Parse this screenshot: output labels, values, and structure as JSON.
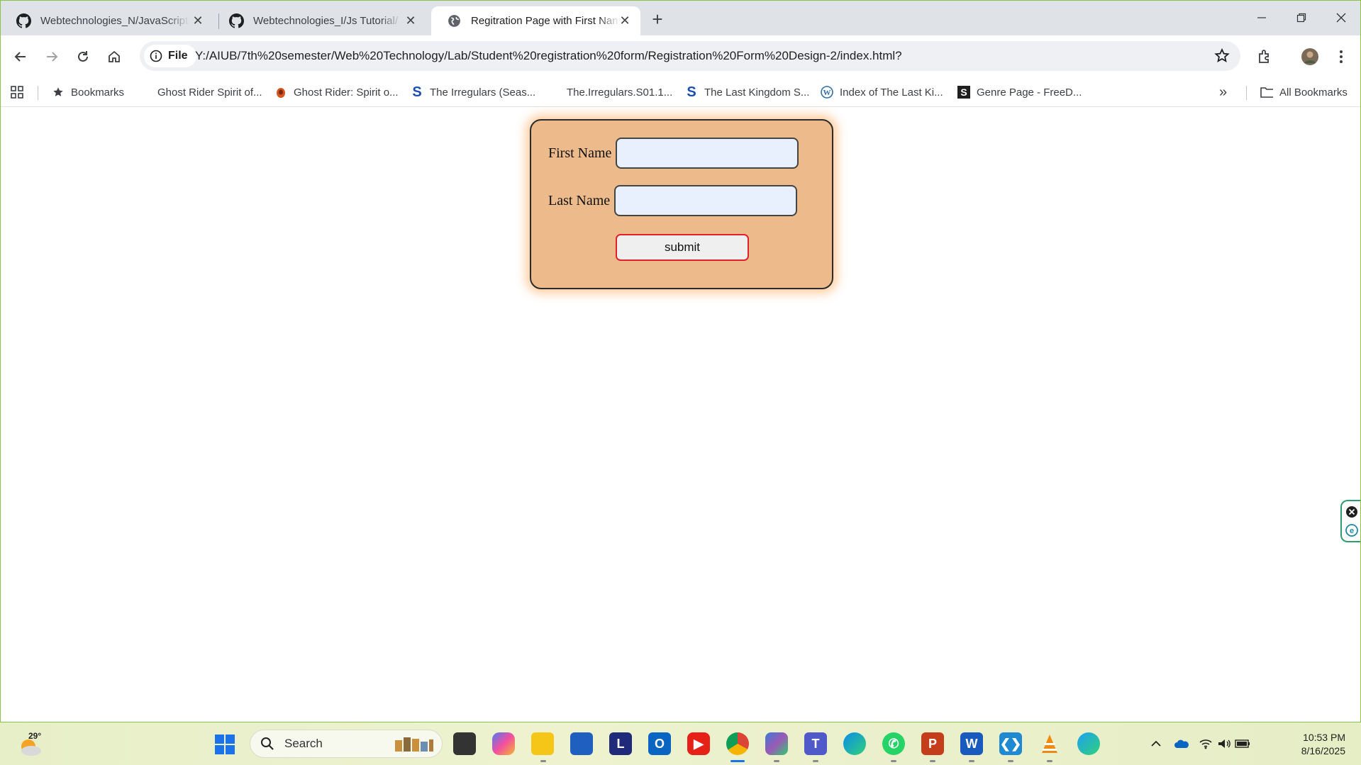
{
  "browser": {
    "tabs": [
      {
        "title": "Webtechnologies_N/JavaScript/",
        "icon": "github-icon",
        "active": false
      },
      {
        "title": "Webtechnologies_I/Js Tutorial/",
        "icon": "github-icon",
        "active": false
      },
      {
        "title": "Regitration Page with First Nam",
        "icon": "globe-icon",
        "active": true
      }
    ],
    "new_tab": "+",
    "site_chip": "File",
    "url": "Y:/AIUB/7th%20semester/Web%20Technology/Lab/Student%20registration%20form/Registration%20Form%20Design-2/index.html?"
  },
  "bookmarks": {
    "items": [
      {
        "label": "Bookmarks",
        "icon": "star-icon"
      },
      {
        "label": "Ghost Rider Spirit of...",
        "icon": "none"
      },
      {
        "label": "Ghost Rider: Spirit o...",
        "icon": "ghost-rider-icon"
      },
      {
        "label": "The Irregulars (Seas...",
        "icon": "s-logo-icon"
      },
      {
        "label": "The.Irregulars.S01.1...",
        "icon": "none"
      },
      {
        "label": "The Last Kingdom S...",
        "icon": "s-logo-icon"
      },
      {
        "label": "Index of The Last Ki...",
        "icon": "wordpress-icon"
      },
      {
        "label": "Genre Page - FreeD...",
        "icon": "s-dark-logo-icon"
      }
    ],
    "overflow": "»",
    "all_bookmarks": "All Bookmarks"
  },
  "form": {
    "first_name_label": "First Name",
    "first_name_value": "",
    "last_name_label": "Last Name",
    "last_name_value": "",
    "submit_label": "submit",
    "background": "#edbb8b",
    "button_border": "#e0202a"
  },
  "taskbar": {
    "weather_temp": "29°",
    "search_placeholder": "Search",
    "apps": [
      "file-explorer-task-view-icon",
      "copilot-icon",
      "folder-icon",
      "store-icon",
      "l-app-icon",
      "outlook-icon",
      "youtube-icon",
      "chrome-icon",
      "m365-icon",
      "teams-icon",
      "edge-icon",
      "whatsapp-icon",
      "powerpoint-icon",
      "word-icon",
      "vscode-icon",
      "vlc-icon",
      "edge-dev-icon"
    ],
    "clock_time": "10:53 PM",
    "clock_date": "8/16/2025"
  }
}
